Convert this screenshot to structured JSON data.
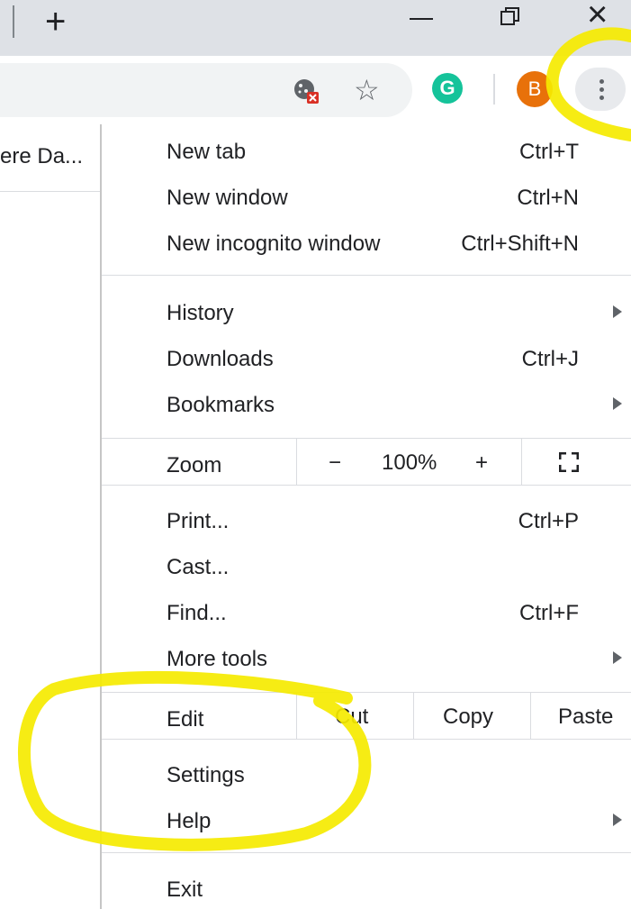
{
  "window": {
    "new_tab_glyph": "+",
    "close_glyph": "×"
  },
  "toolbar": {
    "grammarly_letter": "G",
    "avatar_letter": "B",
    "star_glyph": "☆"
  },
  "page": {
    "truncated_title": "ere Da..."
  },
  "menu": {
    "new_tab": {
      "label": "New tab",
      "shortcut": "Ctrl+T"
    },
    "new_window": {
      "label": "New window",
      "shortcut": "Ctrl+N"
    },
    "new_incognito": {
      "label": "New incognito window",
      "shortcut": "Ctrl+Shift+N"
    },
    "history": {
      "label": "History"
    },
    "downloads": {
      "label": "Downloads",
      "shortcut": "Ctrl+J"
    },
    "bookmarks": {
      "label": "Bookmarks"
    },
    "zoom": {
      "label": "Zoom",
      "minus": "−",
      "level": "100%",
      "plus": "+"
    },
    "print": {
      "label": "Print...",
      "shortcut": "Ctrl+P"
    },
    "cast": {
      "label": "Cast..."
    },
    "find": {
      "label": "Find...",
      "shortcut": "Ctrl+F"
    },
    "more_tools": {
      "label": "More tools"
    },
    "edit": {
      "label": "Edit",
      "cut": "Cut",
      "copy": "Copy",
      "paste": "Paste"
    },
    "settings": {
      "label": "Settings"
    },
    "help": {
      "label": "Help"
    },
    "exit": {
      "label": "Exit"
    }
  },
  "colors": {
    "highlight": "#f5ea00",
    "avatar": "#e8710a",
    "grammarly": "#15c39a"
  }
}
